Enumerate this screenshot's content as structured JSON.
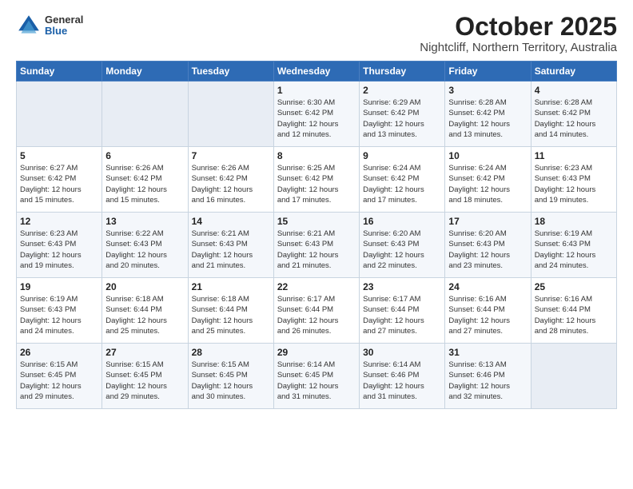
{
  "header": {
    "logo_general": "General",
    "logo_blue": "Blue",
    "title": "October 2025",
    "subtitle": "Nightcliff, Northern Territory, Australia"
  },
  "days_of_week": [
    "Sunday",
    "Monday",
    "Tuesday",
    "Wednesday",
    "Thursday",
    "Friday",
    "Saturday"
  ],
  "weeks": [
    [
      {
        "day": "",
        "info": ""
      },
      {
        "day": "",
        "info": ""
      },
      {
        "day": "",
        "info": ""
      },
      {
        "day": "1",
        "info": "Sunrise: 6:30 AM\nSunset: 6:42 PM\nDaylight: 12 hours\nand 12 minutes."
      },
      {
        "day": "2",
        "info": "Sunrise: 6:29 AM\nSunset: 6:42 PM\nDaylight: 12 hours\nand 13 minutes."
      },
      {
        "day": "3",
        "info": "Sunrise: 6:28 AM\nSunset: 6:42 PM\nDaylight: 12 hours\nand 13 minutes."
      },
      {
        "day": "4",
        "info": "Sunrise: 6:28 AM\nSunset: 6:42 PM\nDaylight: 12 hours\nand 14 minutes."
      }
    ],
    [
      {
        "day": "5",
        "info": "Sunrise: 6:27 AM\nSunset: 6:42 PM\nDaylight: 12 hours\nand 15 minutes."
      },
      {
        "day": "6",
        "info": "Sunrise: 6:26 AM\nSunset: 6:42 PM\nDaylight: 12 hours\nand 15 minutes."
      },
      {
        "day": "7",
        "info": "Sunrise: 6:26 AM\nSunset: 6:42 PM\nDaylight: 12 hours\nand 16 minutes."
      },
      {
        "day": "8",
        "info": "Sunrise: 6:25 AM\nSunset: 6:42 PM\nDaylight: 12 hours\nand 17 minutes."
      },
      {
        "day": "9",
        "info": "Sunrise: 6:24 AM\nSunset: 6:42 PM\nDaylight: 12 hours\nand 17 minutes."
      },
      {
        "day": "10",
        "info": "Sunrise: 6:24 AM\nSunset: 6:42 PM\nDaylight: 12 hours\nand 18 minutes."
      },
      {
        "day": "11",
        "info": "Sunrise: 6:23 AM\nSunset: 6:43 PM\nDaylight: 12 hours\nand 19 minutes."
      }
    ],
    [
      {
        "day": "12",
        "info": "Sunrise: 6:23 AM\nSunset: 6:43 PM\nDaylight: 12 hours\nand 19 minutes."
      },
      {
        "day": "13",
        "info": "Sunrise: 6:22 AM\nSunset: 6:43 PM\nDaylight: 12 hours\nand 20 minutes."
      },
      {
        "day": "14",
        "info": "Sunrise: 6:21 AM\nSunset: 6:43 PM\nDaylight: 12 hours\nand 21 minutes."
      },
      {
        "day": "15",
        "info": "Sunrise: 6:21 AM\nSunset: 6:43 PM\nDaylight: 12 hours\nand 21 minutes."
      },
      {
        "day": "16",
        "info": "Sunrise: 6:20 AM\nSunset: 6:43 PM\nDaylight: 12 hours\nand 22 minutes."
      },
      {
        "day": "17",
        "info": "Sunrise: 6:20 AM\nSunset: 6:43 PM\nDaylight: 12 hours\nand 23 minutes."
      },
      {
        "day": "18",
        "info": "Sunrise: 6:19 AM\nSunset: 6:43 PM\nDaylight: 12 hours\nand 24 minutes."
      }
    ],
    [
      {
        "day": "19",
        "info": "Sunrise: 6:19 AM\nSunset: 6:43 PM\nDaylight: 12 hours\nand 24 minutes."
      },
      {
        "day": "20",
        "info": "Sunrise: 6:18 AM\nSunset: 6:44 PM\nDaylight: 12 hours\nand 25 minutes."
      },
      {
        "day": "21",
        "info": "Sunrise: 6:18 AM\nSunset: 6:44 PM\nDaylight: 12 hours\nand 25 minutes."
      },
      {
        "day": "22",
        "info": "Sunrise: 6:17 AM\nSunset: 6:44 PM\nDaylight: 12 hours\nand 26 minutes."
      },
      {
        "day": "23",
        "info": "Sunrise: 6:17 AM\nSunset: 6:44 PM\nDaylight: 12 hours\nand 27 minutes."
      },
      {
        "day": "24",
        "info": "Sunrise: 6:16 AM\nSunset: 6:44 PM\nDaylight: 12 hours\nand 27 minutes."
      },
      {
        "day": "25",
        "info": "Sunrise: 6:16 AM\nSunset: 6:44 PM\nDaylight: 12 hours\nand 28 minutes."
      }
    ],
    [
      {
        "day": "26",
        "info": "Sunrise: 6:15 AM\nSunset: 6:45 PM\nDaylight: 12 hours\nand 29 minutes."
      },
      {
        "day": "27",
        "info": "Sunrise: 6:15 AM\nSunset: 6:45 PM\nDaylight: 12 hours\nand 29 minutes."
      },
      {
        "day": "28",
        "info": "Sunrise: 6:15 AM\nSunset: 6:45 PM\nDaylight: 12 hours\nand 30 minutes."
      },
      {
        "day": "29",
        "info": "Sunrise: 6:14 AM\nSunset: 6:45 PM\nDaylight: 12 hours\nand 31 minutes."
      },
      {
        "day": "30",
        "info": "Sunrise: 6:14 AM\nSunset: 6:46 PM\nDaylight: 12 hours\nand 31 minutes."
      },
      {
        "day": "31",
        "info": "Sunrise: 6:13 AM\nSunset: 6:46 PM\nDaylight: 12 hours\nand 32 minutes."
      },
      {
        "day": "",
        "info": ""
      }
    ]
  ]
}
